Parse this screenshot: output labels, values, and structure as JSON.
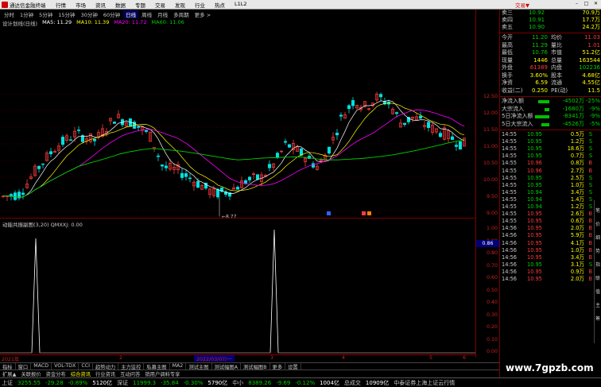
{
  "titlebar": {
    "app_name": "通达信金融终端",
    "menu": [
      "行情",
      "市场",
      "资讯",
      "数据",
      "专题",
      "交易",
      "发现",
      "行业",
      "热点",
      "L1L2"
    ],
    "brand": "交易▼"
  },
  "periods": [
    "分时",
    "1分钟",
    "5分钟",
    "15分钟",
    "30分钟",
    "60分钟",
    "日线",
    "周线",
    "月线",
    "多周期",
    "更多 >"
  ],
  "period_active_index": 6,
  "ma_legend": {
    "title": "设计划线(日线)",
    "ma5": "MA5: 11.29",
    "ma10": "MA10: 11.39",
    "ma20": "MA20: 11.72",
    "ma60": "MA60: 11.06"
  },
  "indicator_legend": "动能共振副图(3,20)  QMXXJ: 0.00",
  "price_axis": [
    "12.50",
    "12.00",
    "11.50",
    "11.00",
    "10.50",
    "10.00",
    "9.50",
    "9.00"
  ],
  "indicator_axis": [
    "1.00",
    "0.90",
    "0.80",
    "0.70",
    "0.60",
    "0.50",
    "0.40",
    "0.30",
    "0.20",
    "0.10",
    "0.00"
  ],
  "indicator_axis_highlight": "0.86",
  "min_label": "8.77",
  "date_axis": {
    "labels": [
      "2021年",
      "2",
      "3",
      "4",
      "5",
      "6"
    ],
    "cursor": "2022/03/07/一"
  },
  "indicator_tabs": [
    "指标",
    "窗口",
    "MACD",
    "VOL-TDX",
    "CCI",
    "趋势动力",
    "主力监控",
    "私募主图",
    "MA2",
    "测试主图",
    "测试幅图A",
    "测试幅图B",
    "更多",
    "设置"
  ],
  "info_tabs": [
    "扩展▲",
    "关联报价",
    "资金分布",
    "综合资讯",
    "行业资讯",
    "互动问答",
    "销用户调料专享"
  ],
  "info_highlight_index": 3,
  "statusbar": {
    "sh_label": "上证",
    "sh_value": "3255.55",
    "sh_change": "-29.28",
    "sh_pct": "-0.89%",
    "sh_amount": "5120亿",
    "sz_label": "深证",
    "sz_value": "11999.3",
    "sz_change": "-35.84",
    "sz_pct": "-0.30%",
    "sz_amount": "5790亿",
    "zx_label": "中小",
    "zx_value": "8389.26",
    "zx_change": "-9.69",
    "zx_pct": "-0.12%",
    "zx_amount": "1004亿",
    "total_label": "总成交",
    "total_value": "10909亿",
    "broker": "中泰证券上海上证云行情"
  },
  "quote_panel": {
    "asks": [
      {
        "label": "卖三",
        "price": "10.92",
        "vol": "70.9万"
      },
      {
        "label": "卖四",
        "price": "10.91",
        "vol": "17.7万"
      },
      {
        "label": "卖五",
        "price": "10.90",
        "vol": "24.2万"
      }
    ],
    "stats": [
      {
        "l1": "今开",
        "v1": "11.20",
        "l2": "均价",
        "v2": "11.03"
      },
      {
        "l1": "最高",
        "v1": "11.29",
        "l2": "量比",
        "v2": "1.01"
      },
      {
        "l1": "最低",
        "v1": "10.76",
        "l2": "市值",
        "v2": "51.2亿"
      },
      {
        "l1": "现量",
        "v1": "1446",
        "l2": "总量",
        "v2": "163544"
      },
      {
        "l1": "外盘",
        "v1": "61389",
        "l2": "内盘",
        "v2": "102236"
      },
      {
        "l1": "换手",
        "v1": "3.60%",
        "l2": "股本",
        "v2": "4.68亿"
      },
      {
        "l1": "净资",
        "v1": "6.59",
        "l2": "流通",
        "v2": "4.55亿"
      },
      {
        "l1": "收益(二)",
        "v1": "0.250",
        "l2": "PE(动)",
        "v2": "11.5"
      }
    ],
    "flows": [
      {
        "label": "净流入额",
        "value": "-4502万",
        "pct": "-25%"
      },
      {
        "label": "大宗流入",
        "value": "-1680万",
        "pct": "-9%"
      },
      {
        "label": "5日净流入额",
        "value": "-8341万",
        "pct": "-9%"
      },
      {
        "label": "5日大宗流入",
        "value": "-4526万",
        "pct": "-5%"
      }
    ],
    "ticks": [
      {
        "t": "14:55",
        "p": "10.95",
        "v": "0.5万",
        "d": "S"
      },
      {
        "t": "14:55",
        "p": "10.95",
        "v": "1.2万",
        "d": "S"
      },
      {
        "t": "14:55",
        "p": "10.95",
        "v": "18.6万",
        "d": "S"
      },
      {
        "t": "14:55",
        "p": "10.95",
        "v": "0.7万",
        "d": "S"
      },
      {
        "t": "14:55",
        "p": "10.96",
        "v": "0.8万",
        "d": "B"
      },
      {
        "t": "14:55",
        "p": "10.96",
        "v": "2.7万",
        "d": "B"
      },
      {
        "t": "14:55",
        "p": "10.95",
        "v": "2.5万",
        "d": "S"
      },
      {
        "t": "14:55",
        "p": "10.95",
        "v": "1.0万",
        "d": "S"
      },
      {
        "t": "14:55",
        "p": "10.94",
        "v": "3.4万",
        "d": "S"
      },
      {
        "t": "14:55",
        "p": "10.94",
        "v": "1.4万",
        "d": "S"
      },
      {
        "t": "14:55",
        "p": "10.94",
        "v": "1.2万",
        "d": "S"
      },
      {
        "t": "14:55",
        "p": "10.95",
        "v": "2.6万",
        "d": "B"
      },
      {
        "t": "14:55",
        "p": "10.95",
        "v": "0.6万",
        "d": "B"
      },
      {
        "t": "14:56",
        "p": "10.95",
        "v": "2.0万",
        "d": "B"
      },
      {
        "t": "14:56",
        "p": "10.95",
        "v": "5.9万",
        "d": "B"
      },
      {
        "t": "14:56",
        "p": "10.95",
        "v": "4.1万",
        "d": "B"
      },
      {
        "t": "14:56",
        "p": "10.95",
        "v": "1.0万",
        "d": "B"
      },
      {
        "t": "14:56",
        "p": "10.95",
        "v": "3.4万",
        "d": "B"
      },
      {
        "t": "14:56",
        "p": "10.95",
        "v": "3.1万",
        "d": "S"
      },
      {
        "t": "14:56",
        "p": "10.95",
        "v": "0.9万",
        "d": "B"
      },
      {
        "t": "14:56",
        "p": "10.95",
        "v": "2.0万",
        "d": "B"
      }
    ],
    "side_tabs": [
      "笔",
      "价",
      "细",
      "势",
      "指",
      "联",
      "值",
      "主",
      "筹"
    ]
  },
  "colors": {
    "up": "#ff3b3b",
    "down": "#00e0e0",
    "ma5": "#ffffff",
    "ma10": "#ffff00",
    "ma20": "#ff00ff",
    "ma60": "#00d000",
    "axis": "#d02020"
  },
  "watermark": "www.7gpzb.com"
}
